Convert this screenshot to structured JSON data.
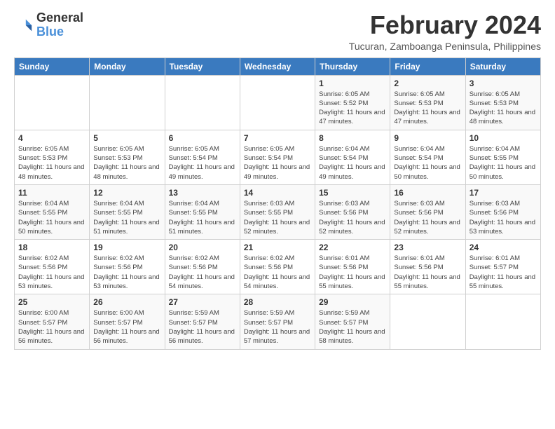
{
  "logo": {
    "text_general": "General",
    "text_blue": "Blue"
  },
  "title": "February 2024",
  "subtitle": "Tucuran, Zamboanga Peninsula, Philippines",
  "days_header": [
    "Sunday",
    "Monday",
    "Tuesday",
    "Wednesday",
    "Thursday",
    "Friday",
    "Saturday"
  ],
  "weeks": [
    [
      {
        "day": "",
        "detail": ""
      },
      {
        "day": "",
        "detail": ""
      },
      {
        "day": "",
        "detail": ""
      },
      {
        "day": "",
        "detail": ""
      },
      {
        "day": "1",
        "detail": "Sunrise: 6:05 AM\nSunset: 5:52 PM\nDaylight: 11 hours and 47 minutes."
      },
      {
        "day": "2",
        "detail": "Sunrise: 6:05 AM\nSunset: 5:53 PM\nDaylight: 11 hours and 47 minutes."
      },
      {
        "day": "3",
        "detail": "Sunrise: 6:05 AM\nSunset: 5:53 PM\nDaylight: 11 hours and 48 minutes."
      }
    ],
    [
      {
        "day": "4",
        "detail": "Sunrise: 6:05 AM\nSunset: 5:53 PM\nDaylight: 11 hours and 48 minutes."
      },
      {
        "day": "5",
        "detail": "Sunrise: 6:05 AM\nSunset: 5:53 PM\nDaylight: 11 hours and 48 minutes."
      },
      {
        "day": "6",
        "detail": "Sunrise: 6:05 AM\nSunset: 5:54 PM\nDaylight: 11 hours and 49 minutes."
      },
      {
        "day": "7",
        "detail": "Sunrise: 6:05 AM\nSunset: 5:54 PM\nDaylight: 11 hours and 49 minutes."
      },
      {
        "day": "8",
        "detail": "Sunrise: 6:04 AM\nSunset: 5:54 PM\nDaylight: 11 hours and 49 minutes."
      },
      {
        "day": "9",
        "detail": "Sunrise: 6:04 AM\nSunset: 5:54 PM\nDaylight: 11 hours and 50 minutes."
      },
      {
        "day": "10",
        "detail": "Sunrise: 6:04 AM\nSunset: 5:55 PM\nDaylight: 11 hours and 50 minutes."
      }
    ],
    [
      {
        "day": "11",
        "detail": "Sunrise: 6:04 AM\nSunset: 5:55 PM\nDaylight: 11 hours and 50 minutes."
      },
      {
        "day": "12",
        "detail": "Sunrise: 6:04 AM\nSunset: 5:55 PM\nDaylight: 11 hours and 51 minutes."
      },
      {
        "day": "13",
        "detail": "Sunrise: 6:04 AM\nSunset: 5:55 PM\nDaylight: 11 hours and 51 minutes."
      },
      {
        "day": "14",
        "detail": "Sunrise: 6:03 AM\nSunset: 5:55 PM\nDaylight: 11 hours and 52 minutes."
      },
      {
        "day": "15",
        "detail": "Sunrise: 6:03 AM\nSunset: 5:56 PM\nDaylight: 11 hours and 52 minutes."
      },
      {
        "day": "16",
        "detail": "Sunrise: 6:03 AM\nSunset: 5:56 PM\nDaylight: 11 hours and 52 minutes."
      },
      {
        "day": "17",
        "detail": "Sunrise: 6:03 AM\nSunset: 5:56 PM\nDaylight: 11 hours and 53 minutes."
      }
    ],
    [
      {
        "day": "18",
        "detail": "Sunrise: 6:02 AM\nSunset: 5:56 PM\nDaylight: 11 hours and 53 minutes."
      },
      {
        "day": "19",
        "detail": "Sunrise: 6:02 AM\nSunset: 5:56 PM\nDaylight: 11 hours and 53 minutes."
      },
      {
        "day": "20",
        "detail": "Sunrise: 6:02 AM\nSunset: 5:56 PM\nDaylight: 11 hours and 54 minutes."
      },
      {
        "day": "21",
        "detail": "Sunrise: 6:02 AM\nSunset: 5:56 PM\nDaylight: 11 hours and 54 minutes."
      },
      {
        "day": "22",
        "detail": "Sunrise: 6:01 AM\nSunset: 5:56 PM\nDaylight: 11 hours and 55 minutes."
      },
      {
        "day": "23",
        "detail": "Sunrise: 6:01 AM\nSunset: 5:56 PM\nDaylight: 11 hours and 55 minutes."
      },
      {
        "day": "24",
        "detail": "Sunrise: 6:01 AM\nSunset: 5:57 PM\nDaylight: 11 hours and 55 minutes."
      }
    ],
    [
      {
        "day": "25",
        "detail": "Sunrise: 6:00 AM\nSunset: 5:57 PM\nDaylight: 11 hours and 56 minutes."
      },
      {
        "day": "26",
        "detail": "Sunrise: 6:00 AM\nSunset: 5:57 PM\nDaylight: 11 hours and 56 minutes."
      },
      {
        "day": "27",
        "detail": "Sunrise: 5:59 AM\nSunset: 5:57 PM\nDaylight: 11 hours and 56 minutes."
      },
      {
        "day": "28",
        "detail": "Sunrise: 5:59 AM\nSunset: 5:57 PM\nDaylight: 11 hours and 57 minutes."
      },
      {
        "day": "29",
        "detail": "Sunrise: 5:59 AM\nSunset: 5:57 PM\nDaylight: 11 hours and 58 minutes."
      },
      {
        "day": "",
        "detail": ""
      },
      {
        "day": "",
        "detail": ""
      }
    ]
  ]
}
